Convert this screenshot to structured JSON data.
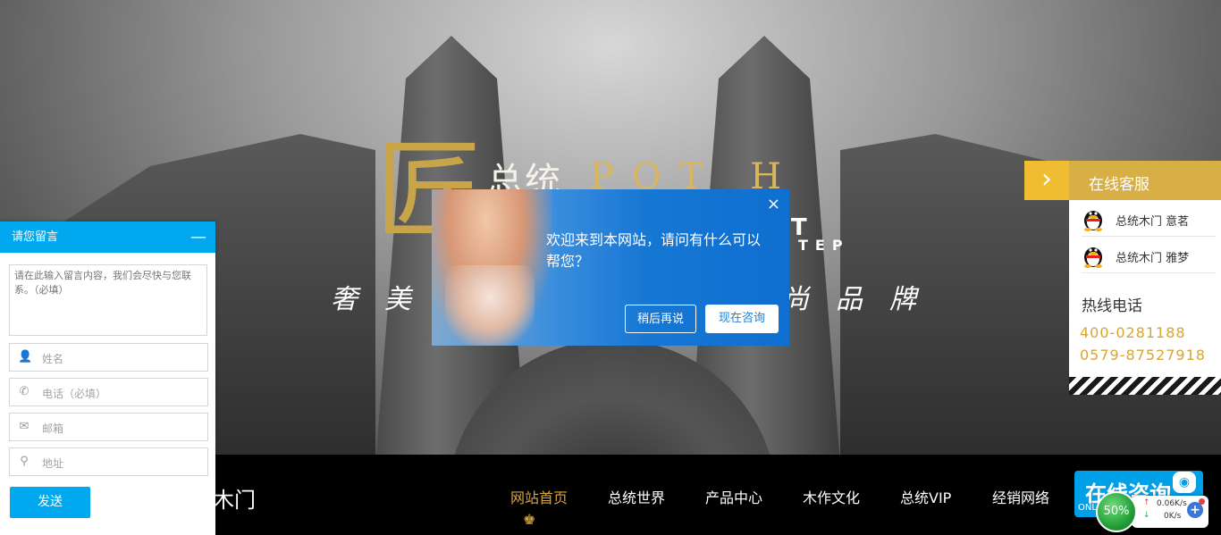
{
  "hero": {
    "logo_mark": "匠",
    "logo_cn": "总统",
    "logo_en": "POT H",
    "logo_sub": "RT",
    "logo_sub2": "TEP",
    "slogan_left": "奢美总",
    "slogan_right": "尚品牌"
  },
  "nav": {
    "brand": "木门",
    "items": [
      "网站首页",
      "总统世界",
      "产品中心",
      "木作文化",
      "总统VIP",
      "经销网络"
    ],
    "active_index": 0,
    "ornament": "♚",
    "consult_button": "在线咨询",
    "consult_sub": "ONL",
    "accent_color": "#d9a442"
  },
  "message_panel": {
    "title": "请您留言",
    "minimize": "—",
    "textarea_placeholder": "请在此输入留言内容，我们会尽快与您联系。（必填）",
    "fields": [
      {
        "icon": "person-icon",
        "glyph": "👤",
        "placeholder": "姓名"
      },
      {
        "icon": "phone-icon",
        "glyph": "✆",
        "placeholder": "电话（必填）"
      },
      {
        "icon": "mail-icon",
        "glyph": "✉",
        "placeholder": "邮箱"
      },
      {
        "icon": "location-pin-icon",
        "glyph": "⚲",
        "placeholder": "地址"
      }
    ],
    "send_button": "发送",
    "accent_color": "#00a8ef"
  },
  "popup": {
    "close": "×",
    "text": "欢迎来到本网站，请问有什么可以帮您？",
    "later_button": "稍后再说",
    "consult_button": "现在咨询"
  },
  "customer_service": {
    "title": "在线客服",
    "arrow": "›",
    "agents": [
      {
        "name": "总统木门  意茗"
      },
      {
        "name": "总统木门  雅梦"
      }
    ],
    "hotline_label": "热线电话",
    "hotlines": [
      "400-0281188",
      "0579-87527918"
    ]
  },
  "speed_widget": {
    "percent": "50%",
    "upload": "0.06K/s",
    "download": "0K/s",
    "up_arrow": "↑",
    "down_arrow": "↓",
    "plus": "+"
  }
}
